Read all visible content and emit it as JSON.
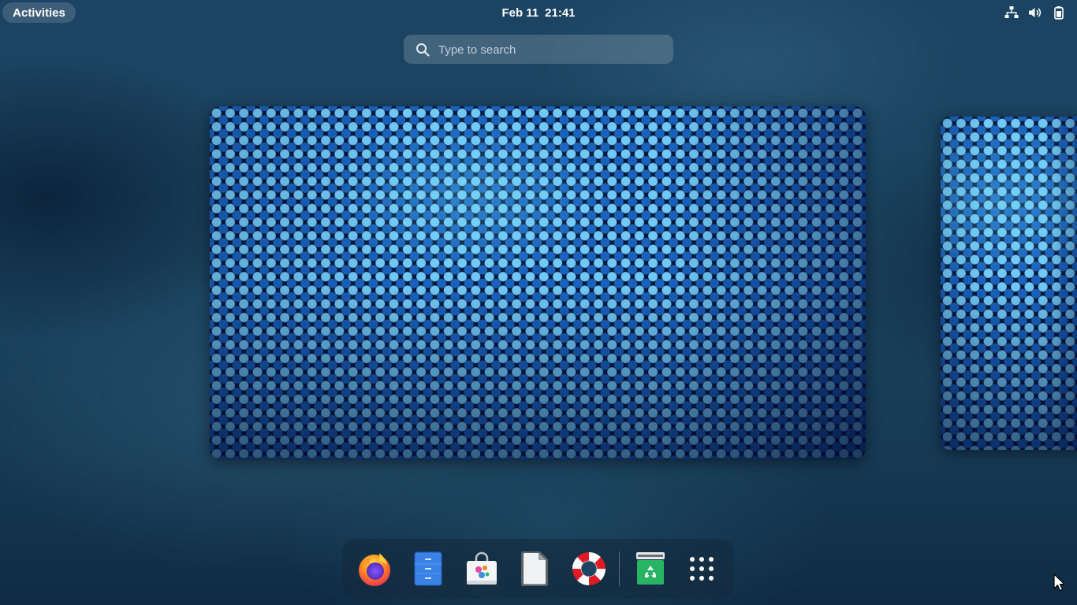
{
  "topbar": {
    "activities_label": "Activities",
    "date": "Feb 11",
    "time": "21:41",
    "tray_icons": [
      "network-icon",
      "volume-icon",
      "battery-icon"
    ]
  },
  "search": {
    "placeholder": "Type to search"
  },
  "workspaces": [
    {
      "name": "workspace-1",
      "active": true
    },
    {
      "name": "workspace-2",
      "active": false
    }
  ],
  "dock": {
    "items": [
      {
        "name": "firefox",
        "icon": "firefox-icon"
      },
      {
        "name": "files",
        "icon": "files-icon"
      },
      {
        "name": "software",
        "icon": "software-icon"
      },
      {
        "name": "text-editor",
        "icon": "document-icon"
      },
      {
        "name": "help",
        "icon": "help-icon"
      },
      {
        "name": "trash",
        "icon": "trash-icon"
      },
      {
        "name": "show-apps",
        "icon": "app-grid-icon"
      }
    ]
  },
  "colors": {
    "background": "#1b4461",
    "panel_text": "#ffffff",
    "wallpaper_dot_light": "#78d2ff",
    "wallpaper_dot_dark": "#1e6ed2"
  }
}
